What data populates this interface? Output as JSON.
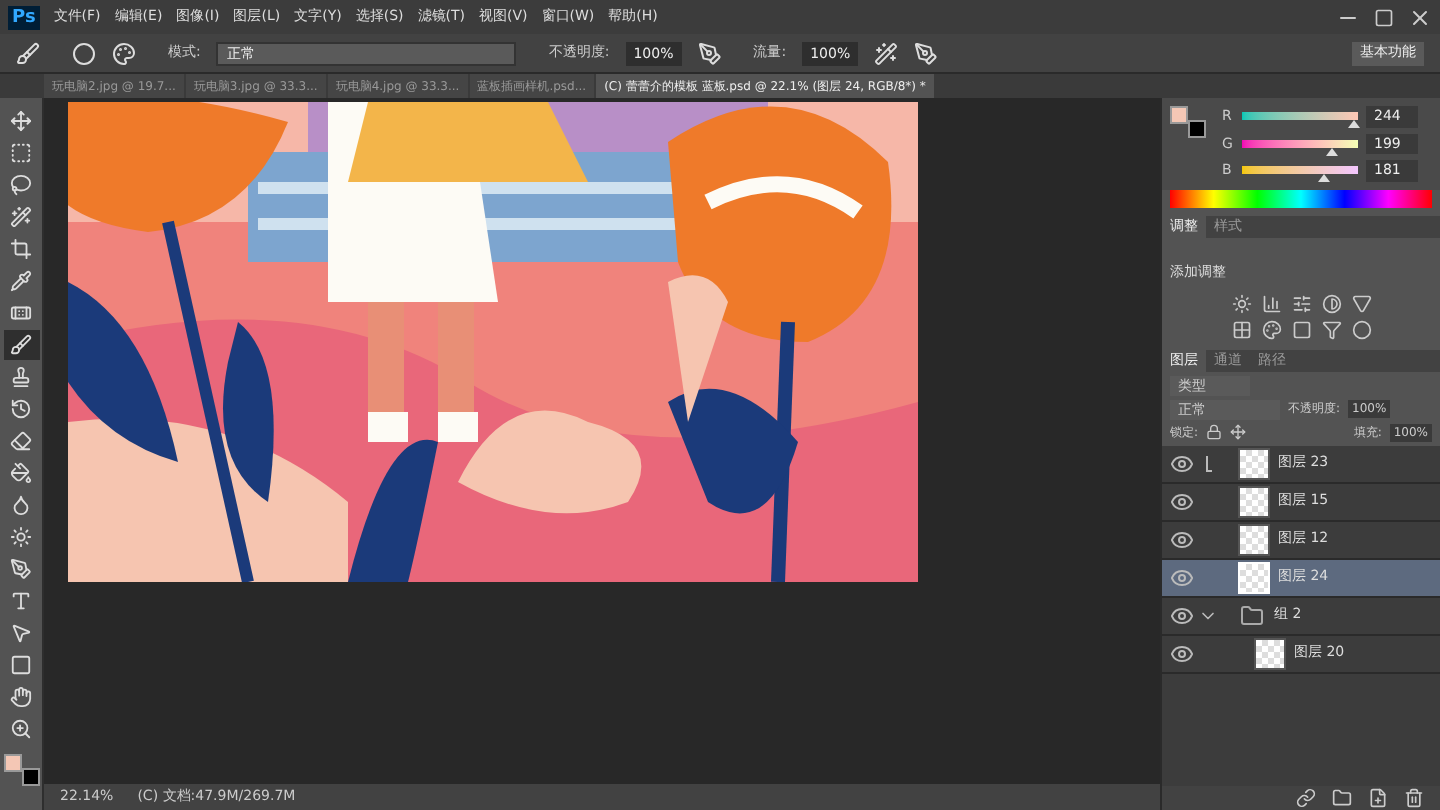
{
  "app": {
    "logo": "Ps",
    "menu": [
      "文件(F)",
      "编辑(E)",
      "图像(I)",
      "图层(L)",
      "文字(Y)",
      "选择(S)",
      "滤镜(T)",
      "视图(V)",
      "窗口(W)",
      "帮助(H)"
    ]
  },
  "options": {
    "mode_label": "模式:",
    "mode": "正常",
    "opacity_label": "不透明度:",
    "opacity": "100%",
    "flow_label": "流量:",
    "flow": "100%",
    "workspace": "基本功能"
  },
  "doc_tabs": [
    {
      "label": "玩电脑2.jpg @ 19.7...",
      "selected": false
    },
    {
      "label": "玩电脑3.jpg @ 33.3...",
      "selected": false
    },
    {
      "label": "玩电脑4.jpg @ 33.3...",
      "selected": false
    },
    {
      "label": "蓝板插画样机.psd...",
      "selected": false
    },
    {
      "label": "(C) 蕾蕾介的模板 蓝板.psd @ 22.1% (图层 24, RGB/8*) *",
      "selected": true
    }
  ],
  "tools": [
    {
      "kind": "move",
      "selected": false
    },
    {
      "kind": "marquee",
      "selected": false
    },
    {
      "kind": "lasso",
      "selected": false
    },
    {
      "kind": "wand",
      "selected": false
    },
    {
      "kind": "crop",
      "selected": false
    },
    {
      "kind": "eyedropper",
      "selected": false
    },
    {
      "kind": "heal",
      "selected": false
    },
    {
      "kind": "brush",
      "selected": true
    },
    {
      "kind": "stamp",
      "selected": false
    },
    {
      "kind": "history",
      "selected": false
    },
    {
      "kind": "eraser",
      "selected": false
    },
    {
      "kind": "bucket",
      "selected": false
    },
    {
      "kind": "blur",
      "selected": false
    },
    {
      "kind": "dodge",
      "selected": false
    },
    {
      "kind": "pen",
      "selected": false
    },
    {
      "kind": "type",
      "selected": false
    },
    {
      "kind": "select",
      "selected": false
    },
    {
      "kind": "shape",
      "selected": false
    },
    {
      "kind": "hand",
      "selected": false
    },
    {
      "kind": "zoom",
      "selected": false
    }
  ],
  "color_panel": {
    "channels": [
      {
        "label": "R",
        "value": "244",
        "level": 0.957
      },
      {
        "label": "G",
        "value": "199",
        "level": 0.78
      },
      {
        "label": "B",
        "value": "181",
        "level": 0.71
      }
    ]
  },
  "adjust_panel": {
    "tabs": [
      {
        "label": "调整",
        "selected": true
      },
      {
        "label": "样式",
        "selected": false
      }
    ],
    "title": "添加调整"
  },
  "layers_panel": {
    "tabs": [
      {
        "label": "图层",
        "selected": true
      },
      {
        "label": "通道",
        "selected": false
      },
      {
        "label": "路径",
        "selected": false
      }
    ],
    "filter": "类型",
    "blend": "正常",
    "opacity_label": "不透明度:",
    "opacity": "100%",
    "lock_label": "锁定:",
    "fill_label": "填充:",
    "fill": "100%",
    "layers": [
      {
        "kind": "layer",
        "name": "图层 23",
        "selected": false,
        "clipped": true
      },
      {
        "kind": "layer",
        "name": "图层 15",
        "selected": false,
        "clipped": false
      },
      {
        "kind": "layer",
        "name": "图层 12",
        "selected": false,
        "clipped": false
      },
      {
        "kind": "layer",
        "name": "图层 24",
        "selected": true,
        "clipped": false
      },
      {
        "kind": "group",
        "name": "组 2",
        "selected": false,
        "expanded": true,
        "children": [
          {
            "kind": "layer",
            "name": "图层 20",
            "selected": false,
            "clipped": false
          }
        ]
      }
    ]
  },
  "status_bar": {
    "zoom": "22.14%",
    "doc": "(C) 文档:47.9M/269.7M"
  }
}
